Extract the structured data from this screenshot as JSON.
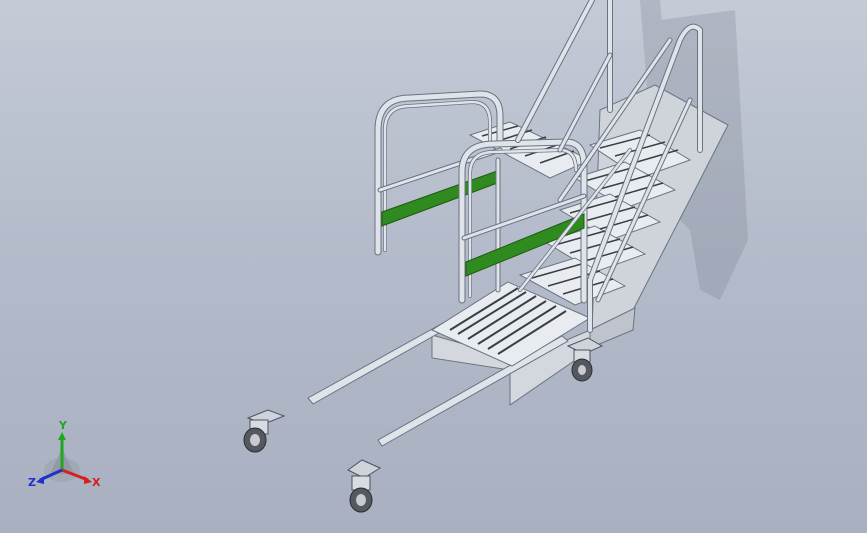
{
  "viewport": {
    "background_top": "#c4cad6",
    "background_bottom": "#a8b0c1"
  },
  "model": {
    "description_icon": "rolling-stair-platform-3d-model",
    "rail_color": "#dfe3ea",
    "rail_edge_color": "#6b7380",
    "accent_bar_color": "#2f8a1f",
    "tread_color": "#e8ecf0",
    "tread_slot_color": "#3a3e45",
    "panel_color": "#d2d6dc"
  },
  "triad": {
    "x_label": "X",
    "y_label": "Y",
    "z_label": "Z",
    "x_color": "#d42020",
    "y_color": "#1fa81f",
    "z_color": "#2030c8"
  }
}
